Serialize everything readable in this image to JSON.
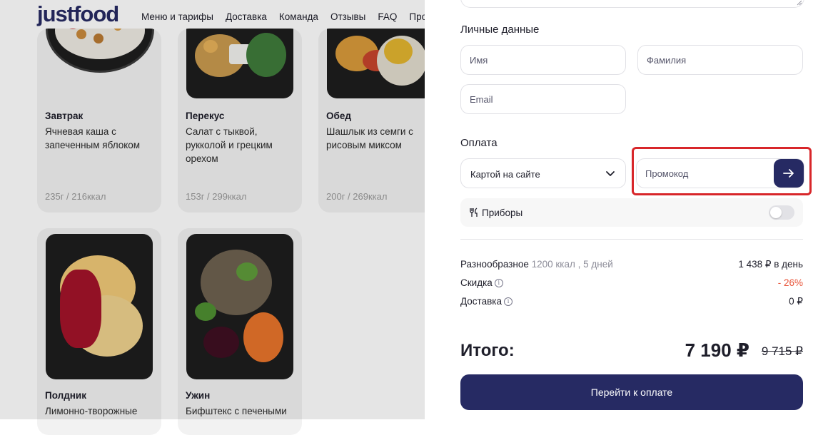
{
  "site": {
    "logo": "justfood",
    "nav": [
      "Меню и тарифы",
      "Доставка",
      "Команда",
      "Отзывы",
      "FAQ",
      "Производ"
    ]
  },
  "menu_cards": [
    {
      "meal": "Завтрак",
      "desc": "Ячневая каша с запеченным яблоком",
      "kcal": "235г / 216ккал"
    },
    {
      "meal": "Перекус",
      "desc": "Салат с тыквой, рукколой и грецким орехом",
      "kcal": "153г / 299ккал"
    },
    {
      "meal": "Обед",
      "desc": "Шашлык из семги с рисовым миксом",
      "kcal": "200г / 269ккал"
    },
    {
      "meal": "Полдник",
      "desc": "Лимонно-творожные",
      "kcal": ""
    },
    {
      "meal": "Ужин",
      "desc": "Бифштекс с печеными",
      "kcal": ""
    }
  ],
  "checkout": {
    "personal_title": "Личные данные",
    "first_name_placeholder": "Имя",
    "last_name_placeholder": "Фамилия",
    "email_placeholder": "Email",
    "payment_title": "Оплата",
    "payment_method": "Картой на сайте",
    "promo_placeholder": "Промокод",
    "cutlery_label": "Приборы",
    "cutlery_enabled": false,
    "plan_name": "Разнообразное",
    "plan_details": "1200 ккал , 5 дней",
    "plan_price": "1 438 ₽ в день",
    "discount_label": "Скидка",
    "discount_value": "- 26%",
    "delivery_label": "Доставка",
    "delivery_value": "0 ₽",
    "total_label": "Итого:",
    "total_value": "7 190 ₽",
    "total_old": "9 715 ₽",
    "pay_button": "Перейти к оплате"
  },
  "colors": {
    "brand": "#262a63",
    "highlight": "#d8262a",
    "discount": "#e8553a"
  }
}
